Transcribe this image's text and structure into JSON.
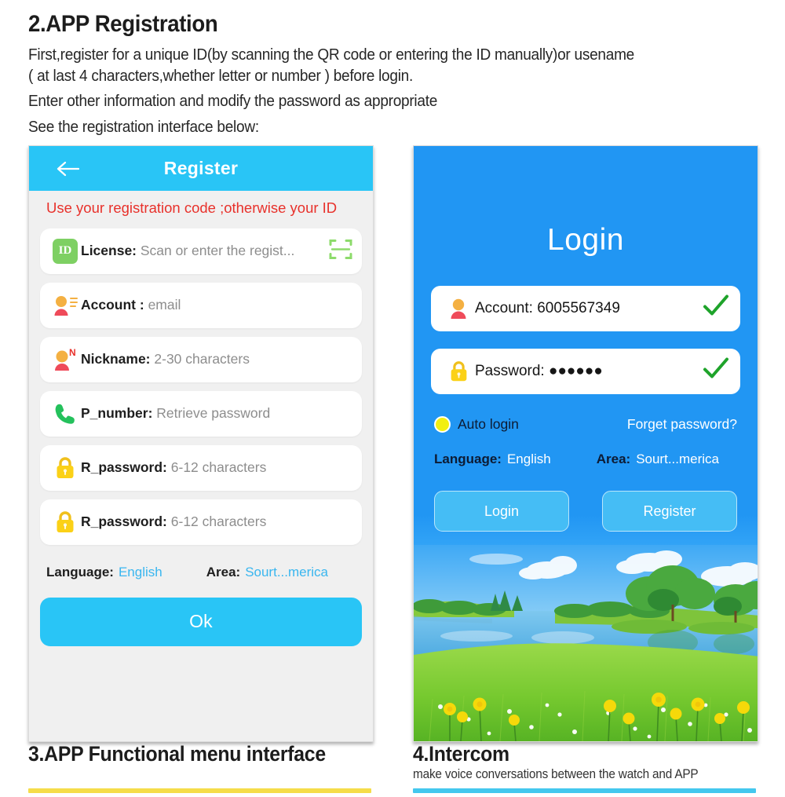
{
  "doc": {
    "heading": "2.APP Registration",
    "para1": "First,register for a unique ID(by scanning the QR code or entering the ID manually)or usename\n( at last 4 characters,whether letter or number ) before login.",
    "para2": "Enter other information and modify the password as appropriate",
    "para3": "See the registration interface below:"
  },
  "register_screen": {
    "title": "Register",
    "back_icon": "back-arrow-icon",
    "warning": "Use your registration code ;otherwise your ID",
    "fields": [
      {
        "icon": "id-badge-icon",
        "icon_text": "ID",
        "label": "License:",
        "value": "Scan or enter the regist...",
        "trailing_icon": "qr-scan-icon"
      },
      {
        "icon": "account-card-icon",
        "label": "Account :",
        "value": "email",
        "trailing_icon": ""
      },
      {
        "icon": "nickname-icon",
        "label": "Nickname:",
        "value": "2-30 characters",
        "trailing_icon": ""
      },
      {
        "icon": "phone-icon",
        "label": "P_number:",
        "value": "Retrieve password",
        "trailing_icon": ""
      },
      {
        "icon": "lock-icon",
        "label": "R_password:",
        "value": "6-12 characters",
        "trailing_icon": ""
      },
      {
        "icon": "lock-icon",
        "label": "R_password:",
        "value": "6-12 characters",
        "trailing_icon": ""
      }
    ],
    "language_label": "Language:",
    "language_value": "English",
    "area_label": "Area:",
    "area_value": "Sourt...merica",
    "ok_label": "Ok"
  },
  "login_screen": {
    "title": "Login",
    "account_label": "Account:",
    "account_value": "6005567349",
    "password_label": "Password:",
    "password_value": "●●●●●●",
    "auto_login_label": "Auto login",
    "forget_password_label": "Forget password?",
    "language_label": "Language:",
    "language_value": "English",
    "area_label": "Area:",
    "area_value": "Sourt...merica",
    "login_button": "Login",
    "register_button": "Register",
    "background_scene": "lake-meadow-flowers-scenery"
  },
  "bottom": {
    "left_title": "3.APP Functional menu interface",
    "right_title": "4.Intercom",
    "right_subtitle": "make voice conversations between the watch and APP"
  },
  "colors": {
    "header_blue": "#29c5f6",
    "login_blue": "#2196f3",
    "warning_red": "#e8312b",
    "link_blue": "#39b6ef",
    "rule_yellow": "#f5dd4a",
    "rule_cyan": "#44c8ee",
    "id_green": "#7ed063",
    "check_green": "#1ea32a",
    "radio_yellow": "#f2ef12"
  }
}
